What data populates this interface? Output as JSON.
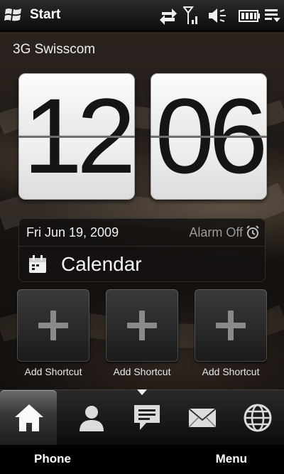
{
  "status_bar": {
    "title": "Start",
    "icons": [
      "windows-start-icon",
      "data-transfer-icon",
      "signal-strength-icon",
      "volume-icon",
      "battery-icon",
      "menu-arrow-icon"
    ]
  },
  "home": {
    "operator": "3G Swisscom",
    "clock": {
      "hour": "12",
      "minute": "06"
    },
    "date": "Fri Jun 19, 2009",
    "alarm": "Alarm Off",
    "calendar_label": "Calendar",
    "shortcuts": [
      {
        "label": "Add Shortcut"
      },
      {
        "label": "Add Shortcut"
      },
      {
        "label": "Add Shortcut"
      }
    ]
  },
  "tabs": [
    {
      "icon": "home-icon",
      "active": true
    },
    {
      "icon": "people-icon",
      "active": false
    },
    {
      "icon": "messaging-icon",
      "active": false
    },
    {
      "icon": "mail-icon",
      "active": false
    },
    {
      "icon": "internet-globe-icon",
      "active": false
    }
  ],
  "softkeys": {
    "left": "Phone",
    "right": "Menu"
  },
  "colors": {
    "background": "#000000",
    "accent": "#ffffff",
    "muted_text": "#9a9a9a"
  }
}
